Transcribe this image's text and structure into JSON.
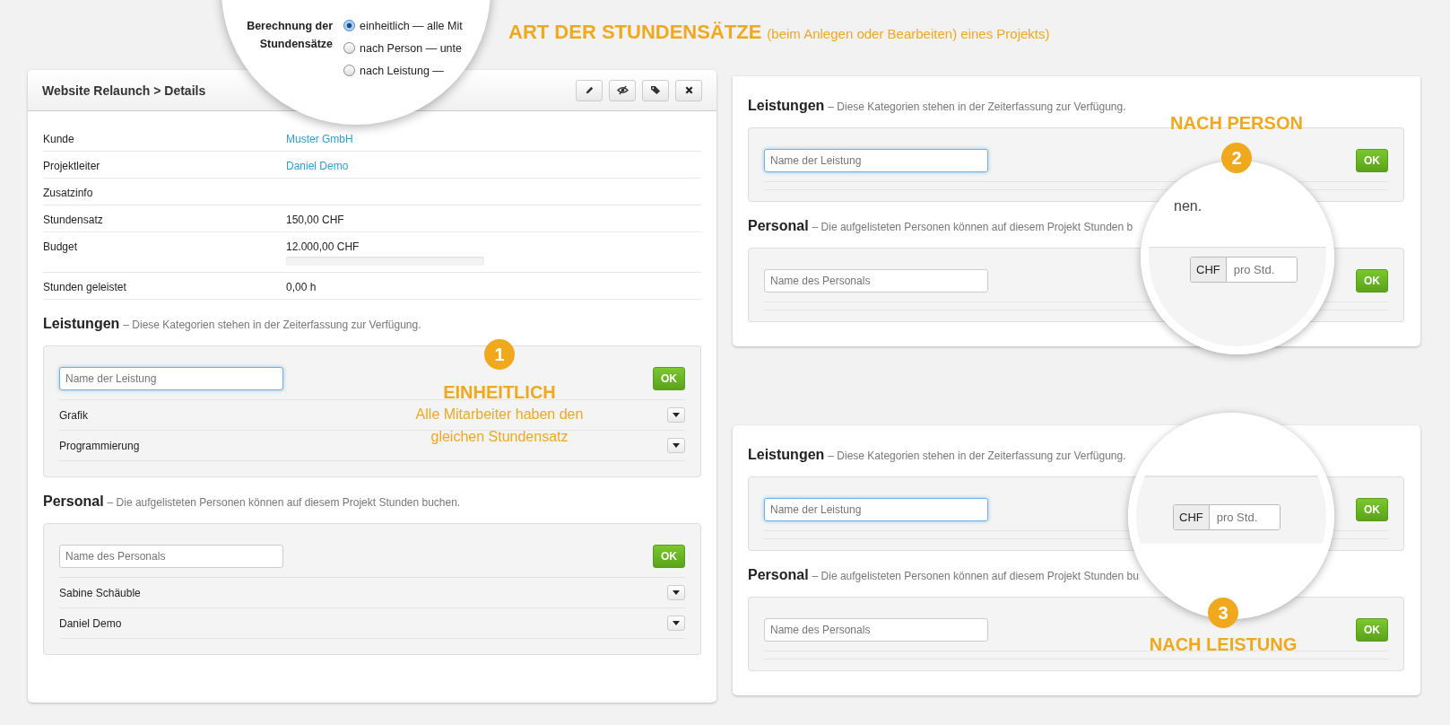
{
  "headline": {
    "title": "ART DER STUNDENSÄTZE",
    "note": "(beim Anlegen oder Bearbeiten) eines Projekts)"
  },
  "rate_setting_zoom": {
    "label": "Berechnung der Stundensätze",
    "options": [
      {
        "label": "einheitlich — alle Mit",
        "selected": true
      },
      {
        "label": "nach Person — unte",
        "selected": false
      },
      {
        "label": "nach Leistung —",
        "selected": false
      }
    ]
  },
  "details_panel": {
    "title": "Website Relaunch > Details",
    "fields": [
      {
        "label": "Kunde",
        "value": "Muster GmbH",
        "kind": "link"
      },
      {
        "label": "Projektleiter",
        "value": "Daniel Demo",
        "kind": "link"
      },
      {
        "label": "Zusatzinfo",
        "kind": "text"
      },
      {
        "label": "Stundensatz",
        "value": "150,00 CHF",
        "kind": "text"
      },
      {
        "label": "Budget",
        "value": "12.000,00 CHF",
        "kind": "progress",
        "level": 0
      },
      {
        "label": "Stunden geleistet",
        "value": "0,00 h",
        "kind": "text"
      }
    ],
    "sections": [
      {
        "title": "Leistungen",
        "description": "– Diese Kategorien stehen in der Zeiterfassung zur Verfügung.",
        "placeholder": "Name der Leistung",
        "focused": true,
        "button": "OK",
        "items": [
          "Grafik",
          "Programmierung"
        ]
      },
      {
        "title": "Personal",
        "description": "– Die aufgelisteten Personen können auf diesem Projekt Stunden buchen.",
        "placeholder": "Name des Personals",
        "focused": false,
        "button": "OK",
        "items": [
          "Sabine Schäuble",
          "Daniel Demo"
        ]
      }
    ]
  },
  "variant_panels": [
    {
      "sections": [
        {
          "title": "Leistungen",
          "description": "– Diese Kategorien stehen in der Zeiterfassung zur Verfügung.",
          "placeholder": "Name der Leistung",
          "focused": true,
          "button": "OK"
        },
        {
          "title": "Personal",
          "description": "– Die aufgelisteten Personen können auf diesem Projekt Stunden b",
          "placeholder": "Name des Personals",
          "focused": false,
          "button": "OK"
        }
      ]
    },
    {
      "sections": [
        {
          "title": "Leistungen",
          "description": "– Diese Kategorien stehen in der Zeiterfassung zur Verfügung.",
          "placeholder": "Name der Leistung",
          "focused": true,
          "button": "OK"
        },
        {
          "title": "Personal",
          "description": "– Die aufgelisteten Personen können auf diesem Projekt Stunden bu",
          "placeholder": "Name des Personals",
          "focused": false,
          "button": "OK"
        }
      ]
    }
  ],
  "callouts": [
    {
      "number": "1",
      "title": "EINHEITLICH",
      "lines": [
        "Alle Mitarbeiter haben den",
        "gleichen Stundensatz"
      ]
    },
    {
      "number": "2",
      "title": "NACH PERSON"
    },
    {
      "number": "3",
      "title": "NACH LEISTUNG"
    }
  ],
  "zooms": [
    {
      "visible_text": "nen.",
      "currency": "CHF",
      "placeholder": "pro Std."
    },
    {
      "currency": "CHF",
      "placeholder": "pro Std."
    }
  ]
}
